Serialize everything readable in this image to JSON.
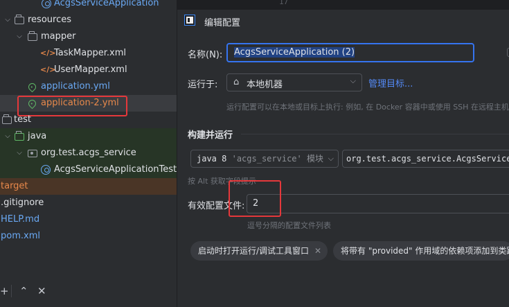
{
  "tree": {
    "items": [
      {
        "label": "AcgsServiceApplication",
        "icon": "spring-class-icon"
      },
      {
        "label": "resources",
        "icon": "folder-icon"
      },
      {
        "label": "mapper",
        "icon": "folder-icon"
      },
      {
        "label": "TaskMapper.xml",
        "icon": "xml-icon"
      },
      {
        "label": "UserMapper.xml",
        "icon": "xml-icon"
      },
      {
        "label": "application.yml",
        "icon": "spring-leaf-icon"
      },
      {
        "label": "application-2.yml",
        "icon": "spring-leaf-icon"
      },
      {
        "label": "test",
        "icon": "folder-icon"
      },
      {
        "label": "java",
        "icon": "folder-icon"
      },
      {
        "label": "org.test.acgs_service",
        "icon": "package-icon"
      },
      {
        "label": "AcgsServiceApplicationTests",
        "icon": "spring-class-icon"
      },
      {
        "label": "target",
        "icon": "none"
      },
      {
        "label": ".gitignore",
        "icon": "none"
      },
      {
        "label": "HELP.md",
        "icon": "none"
      },
      {
        "label": "pom.xml",
        "icon": "none"
      }
    ],
    "colors": {
      "yml": "#6aa9f4",
      "excluded": "#e8894b",
      "text": "#dfe1e5"
    }
  },
  "editor": {
    "line_number": "17"
  },
  "dialog": {
    "title": "编辑配置",
    "name_label": "名称(N):",
    "name_value": "AcgsServiceApplication (2)",
    "run_on_label": "运行于:",
    "run_on_value": "本地机器",
    "manage_targets": "管理目标...",
    "run_on_hint": "运行配置可以在本地或目标上执行: 例如, 在 Docker 容器中或使用 SSH 在远程主机上",
    "build_run_section": "构建并运行",
    "jdk_prefix": "java 8",
    "jdk_module": "'acgs_service'",
    "jdk_suffix": "模块",
    "main_class": "org.test.acgs_service.AcgsServiceApplication",
    "alt_hint": "按 Alt 获取字段提示",
    "active_profiles_label": "有效配置文件:",
    "active_profiles_value": "2",
    "active_profiles_hint": "逗号分隔的配置文件列表",
    "chip_open_tool_window": "启动时打开运行/调试工具窗口",
    "chip_provided_deps": "将带有 \"provided\" 作用域的依赖项添加到类路径"
  },
  "accent": {
    "focus": "#3574f0",
    "link": "#548af7",
    "annotation": "#e5383b"
  }
}
